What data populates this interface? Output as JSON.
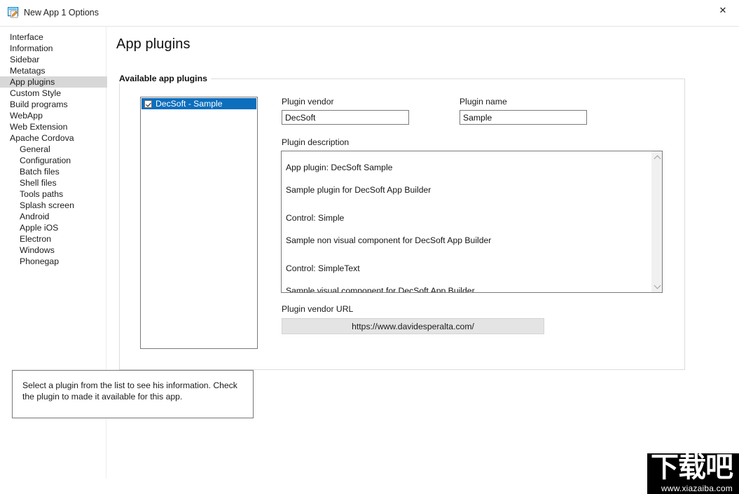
{
  "window": {
    "title": "New App 1 Options",
    "icon": "app-options-icon",
    "close_label": "✕"
  },
  "sidebar": {
    "items": [
      {
        "label": "Interface",
        "indent": false,
        "selected": false
      },
      {
        "label": "Information",
        "indent": false,
        "selected": false
      },
      {
        "label": "Sidebar",
        "indent": false,
        "selected": false
      },
      {
        "label": "Metatags",
        "indent": false,
        "selected": false
      },
      {
        "label": "App plugins",
        "indent": false,
        "selected": true
      },
      {
        "label": "Custom Style",
        "indent": false,
        "selected": false
      },
      {
        "label": "Build programs",
        "indent": false,
        "selected": false
      },
      {
        "label": "WebApp",
        "indent": false,
        "selected": false
      },
      {
        "label": "Web Extension",
        "indent": false,
        "selected": false
      },
      {
        "label": "Apache Cordova",
        "indent": false,
        "selected": false
      },
      {
        "label": "General",
        "indent": true,
        "selected": false
      },
      {
        "label": "Configuration",
        "indent": true,
        "selected": false
      },
      {
        "label": "Batch files",
        "indent": true,
        "selected": false
      },
      {
        "label": "Shell files",
        "indent": true,
        "selected": false
      },
      {
        "label": "Tools paths",
        "indent": true,
        "selected": false
      },
      {
        "label": "Splash screen",
        "indent": true,
        "selected": false
      },
      {
        "label": "Android",
        "indent": true,
        "selected": false
      },
      {
        "label": "Apple iOS",
        "indent": true,
        "selected": false
      },
      {
        "label": "Electron",
        "indent": true,
        "selected": false
      },
      {
        "label": "Windows",
        "indent": true,
        "selected": false
      },
      {
        "label": "Phonegap",
        "indent": true,
        "selected": false
      }
    ]
  },
  "main": {
    "page_title": "App plugins",
    "group_label": "Available app plugins",
    "plugin_list": [
      {
        "label": "DecSoft - Sample",
        "checked": true,
        "selected": true
      }
    ],
    "vendor": {
      "label": "Plugin vendor",
      "value": "DecSoft"
    },
    "name": {
      "label": "Plugin name",
      "value": "Sample"
    },
    "description": {
      "label": "Plugin description",
      "lines": [
        "App plugin: DecSoft Sample",
        "Sample plugin for DecSoft App Builder",
        "",
        "Control: Simple",
        "Sample non visual component for DecSoft App Builder",
        "",
        "Control: SimpleText",
        "Sample visual component for DecSoft App Builder"
      ],
      "scroll_up_icon": "chevron-up-icon",
      "scroll_down_icon": "chevron-down-icon"
    },
    "vendor_url": {
      "label": "Plugin vendor URL",
      "value": "https://www.davidesperalta.com/"
    },
    "hint": "Select a plugin from the list to see his information. Check the plugin to made it available for this app."
  },
  "watermark": {
    "brand": "下载吧",
    "url": "www.xiazaiba.com"
  },
  "colors": {
    "selection_blue": "#0d6ebd",
    "nav_selected_gray": "#d7d7d7",
    "button_face": "#e4e4e4"
  }
}
